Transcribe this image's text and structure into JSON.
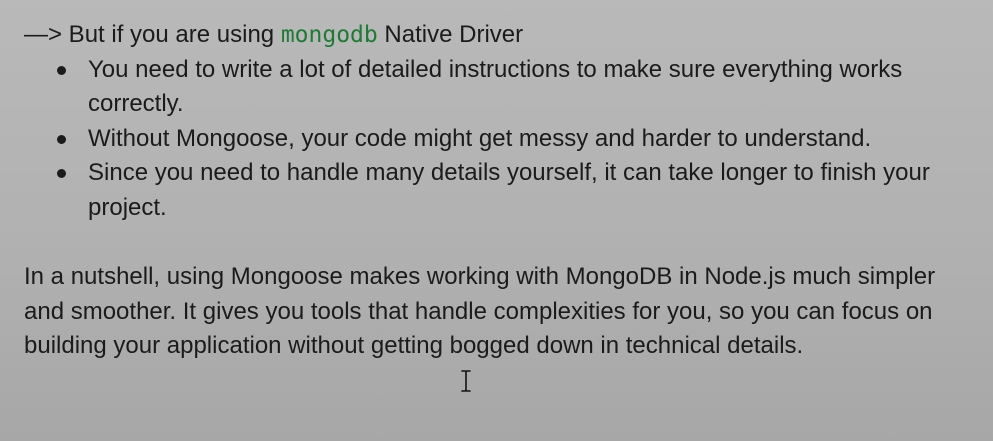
{
  "intro": {
    "prefix": "—> But if you are using ",
    "code": "mongodb",
    "suffix": "  Native Driver"
  },
  "bullets": [
    "You need to write a lot of detailed instructions to make sure everything works correctly.",
    "Without Mongoose, your code might get messy and harder to understand.",
    "Since you need to handle many details yourself, it can take longer to finish your project."
  ],
  "summary": "In a nutshell, using Mongoose makes working with MongoDB in Node.js much simpler and smoother. It gives you tools that handle complexities for you, so you can focus on building your application without getting bogged down in technical details.",
  "cursor_icon": "text-cursor-icon",
  "colors": {
    "code_text": "#1e7a34",
    "body_text": "#1b1b1b",
    "background": "#b3b3b3"
  }
}
